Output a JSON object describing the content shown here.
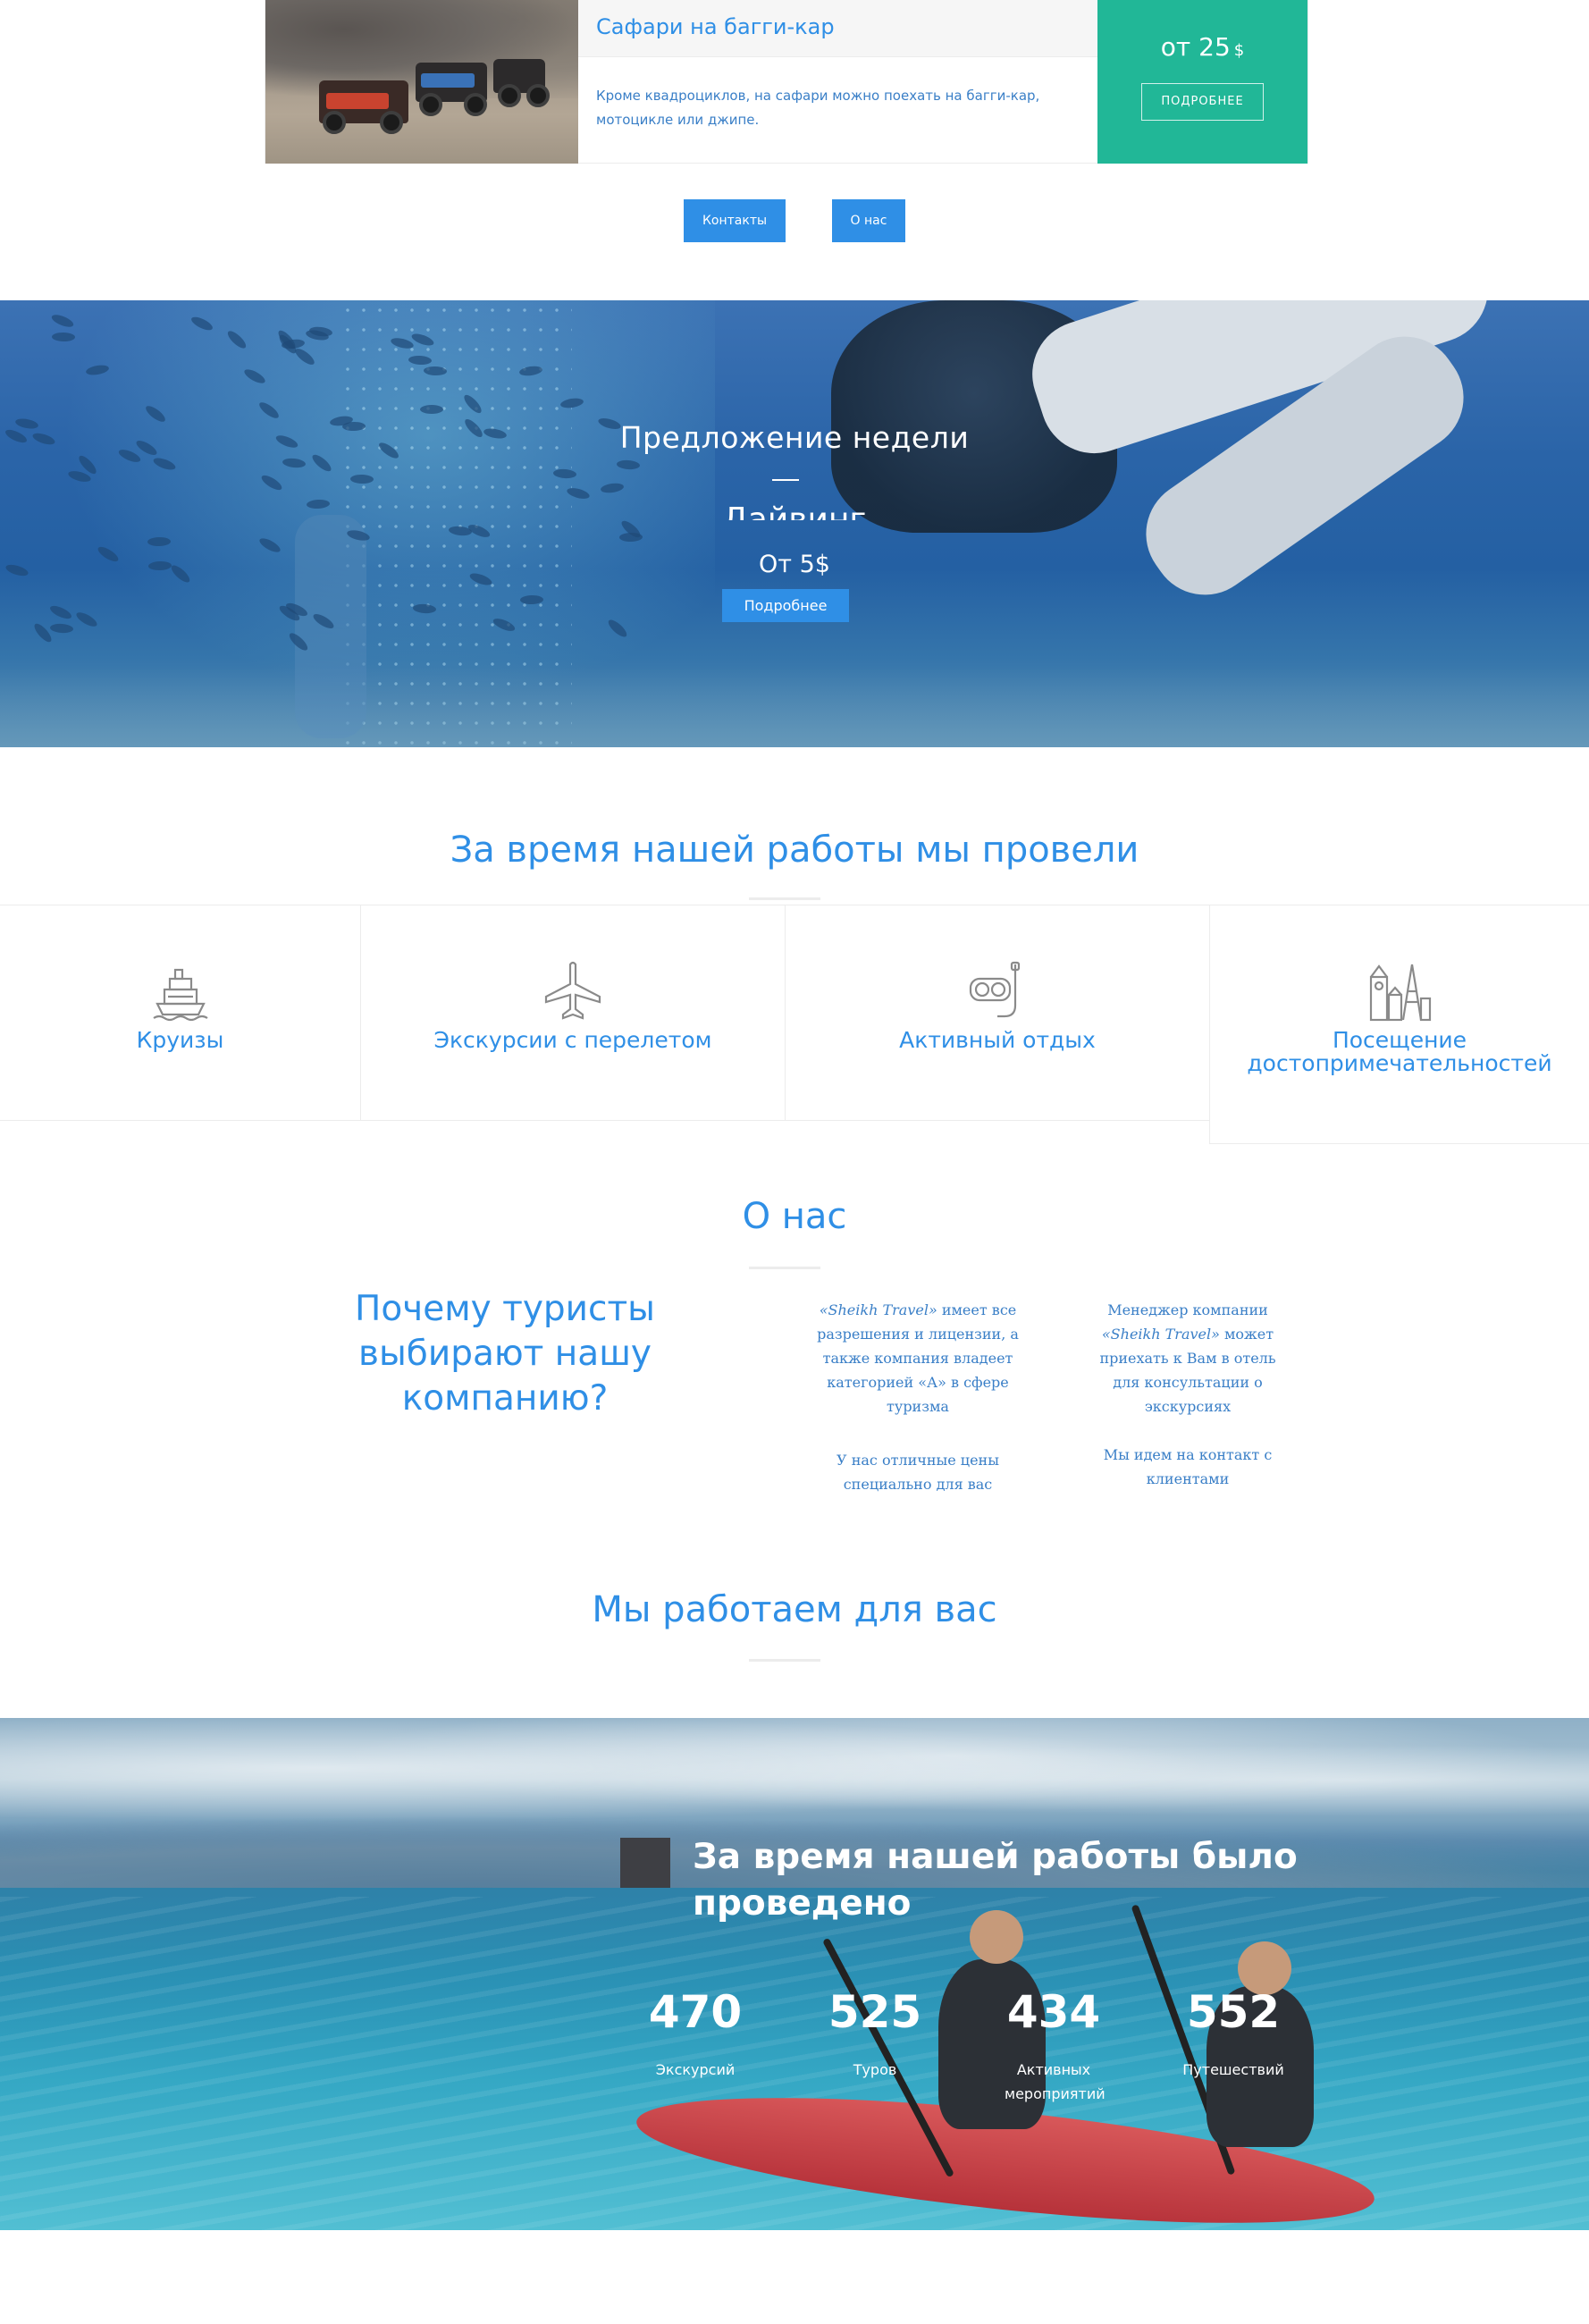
{
  "tour_card": {
    "title": "Сафари на багги-кар",
    "description": "Кроме квадроциклов, на сафари можно поехать на багги-кар, мотоцикле или джипе.",
    "price_prefix": "от",
    "price_value": "25",
    "price_currency": "$",
    "more_label": "ПОДРОБНЕЕ",
    "accent_color": "#21b797"
  },
  "nav_buttons": {
    "contacts": "Контакты",
    "about": "О нас"
  },
  "weekly_offer": {
    "label": "Предложение недели",
    "dash": "—",
    "name": "Дайвинг",
    "price": "От 5$",
    "button": "Подробнее"
  },
  "achievements": {
    "title": "За время нашей работы мы провели",
    "categories": [
      {
        "label": "Круизы",
        "icon": "ship-icon"
      },
      {
        "label": "Экскурсии с перелетом",
        "icon": "airplane-icon"
      },
      {
        "label": "Активный отдых",
        "icon": "diving-mask-icon"
      },
      {
        "label": "Посещение достопримечательностей",
        "icon": "landmarks-icon"
      }
    ]
  },
  "about": {
    "title": "О нас",
    "why_title": "Почему туристы выбирают нашу компанию?",
    "points": [
      {
        "brand": "«Sheikh Travel»",
        "text": " имеет все разрешения и лицензии, а также компания владеет категорией «А» в сфере туризма"
      },
      {
        "text": "Менеджер компании ",
        "brand": "«Sheikh Travel»",
        "text2": " может приехать к Вам в отель для консультации о экскурсиях"
      },
      {
        "text": "У нас отличные цены специально для вас"
      },
      {
        "text": "Мы идем на контакт с клиентами"
      }
    ]
  },
  "work": {
    "title": "Мы работаем для вас"
  },
  "counters": {
    "title": "За время нашей работы было проведено",
    "items": [
      {
        "value": "470",
        "label": "Экскурсий"
      },
      {
        "value": "525",
        "label": "Туров"
      },
      {
        "value": "434",
        "label": "Активных мероприятий"
      },
      {
        "value": "552",
        "label": "Путешествий"
      }
    ]
  },
  "colors": {
    "primary": "#2f8fe6",
    "accent": "#21b797",
    "text": "#3a7fc7"
  }
}
